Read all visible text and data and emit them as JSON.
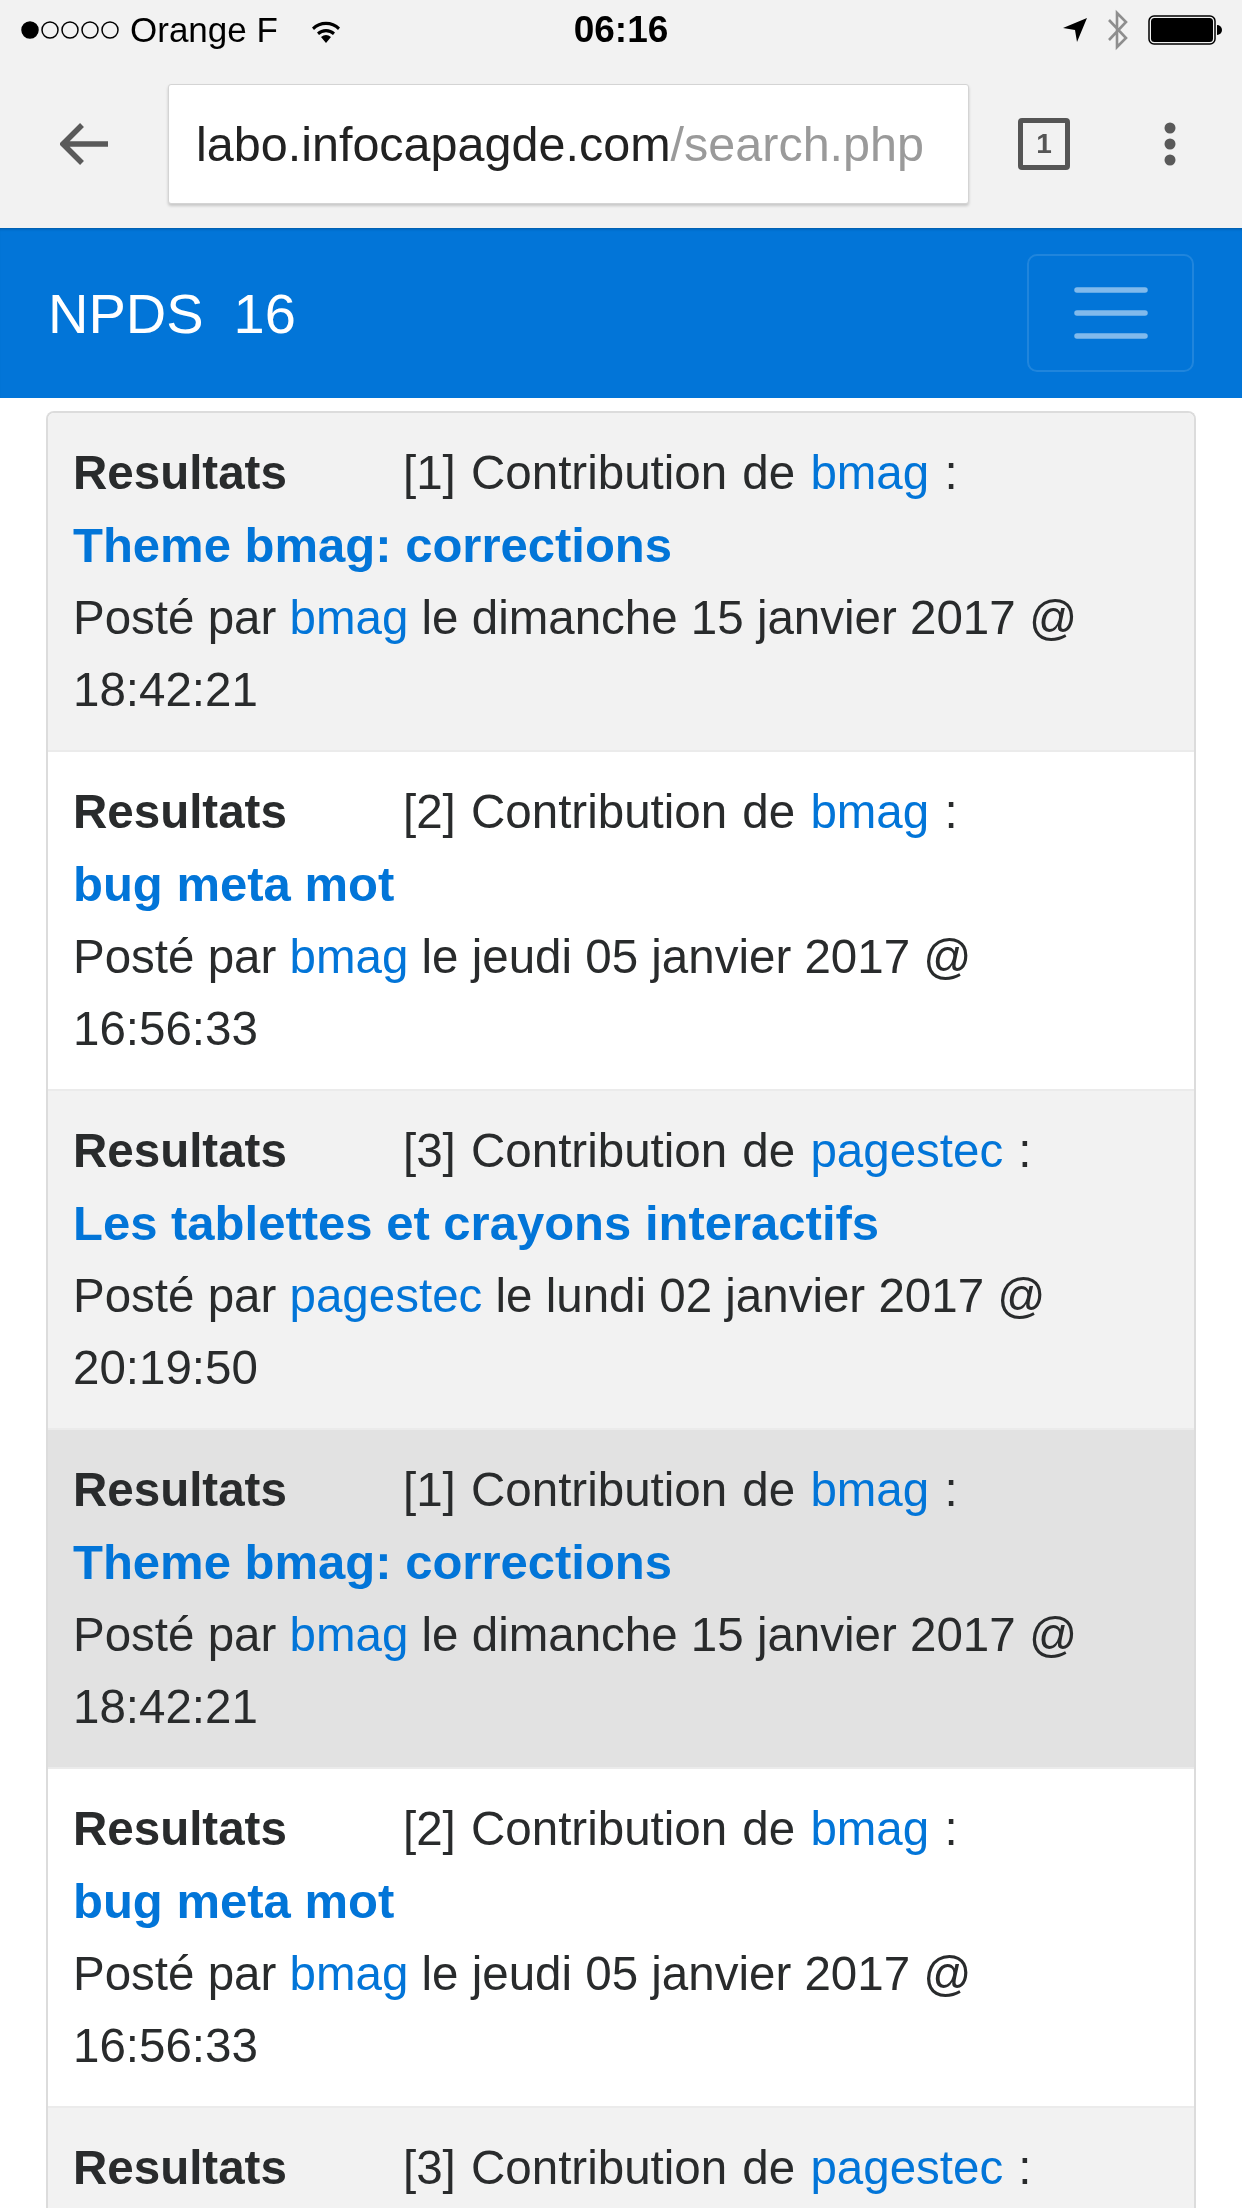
{
  "status_bar": {
    "carrier": "Orange F",
    "time": "06:16"
  },
  "browser": {
    "url_host": "labo.infocapagde.com",
    "url_path": "/search.php",
    "tab_count": "1"
  },
  "navbar": {
    "brand": "NPDS",
    "version": "16"
  },
  "results": [
    {
      "rows": [
        {
          "label": "Resultats",
          "heading": {
            "before": "[1] Contribution de",
            "author": "bmag",
            "after": ":"
          },
          "title": "Theme bmag: corrections",
          "posted": {
            "before": "Posté par",
            "author": "bmag",
            "date": "le dimanche 15 janvier 2017 @",
            "time": "18:42:21"
          },
          "highlighted": false
        },
        {
          "label": "Resultats",
          "heading": {
            "before": "[2] Contribution de",
            "author": "bmag",
            "after": ":"
          },
          "title": "bug meta mot",
          "posted": {
            "before": "Posté par",
            "author": "bmag",
            "date": "le jeudi 05 janvier 2017 @",
            "time": "16:56:33"
          },
          "highlighted": false
        },
        {
          "label": "Resultats",
          "heading": {
            "before": "[3] Contribution de",
            "author": "pagestec",
            "after": ":"
          },
          "title": "Les tablettes et crayons interactifs",
          "posted": {
            "before": "Posté par",
            "author": "pagestec",
            "date": "le lundi 02 janvier 2017 @",
            "time": "20:19:50"
          },
          "highlighted": false
        }
      ]
    },
    {
      "rows": [
        {
          "label": "Resultats",
          "heading": {
            "before": "[1] Contribution de",
            "author": "bmag",
            "after": ":"
          },
          "title": "Theme bmag: corrections",
          "posted": {
            "before": "Posté par",
            "author": "bmag",
            "date": "le dimanche 15 janvier 2017 @",
            "time": "18:42:21"
          },
          "highlighted": true
        },
        {
          "label": "Resultats",
          "heading": {
            "before": "[2] Contribution de",
            "author": "bmag",
            "after": ":"
          },
          "title": "bug meta mot",
          "posted": {
            "before": "Posté par",
            "author": "bmag",
            "date": "le jeudi 05 janvier 2017 @",
            "time": "16:56:33"
          },
          "highlighted": false
        },
        {
          "label": "Resultats",
          "heading": {
            "before": "[3] Contribution de",
            "author": "pagestec",
            "after": ":"
          },
          "highlighted": false
        }
      ]
    }
  ]
}
